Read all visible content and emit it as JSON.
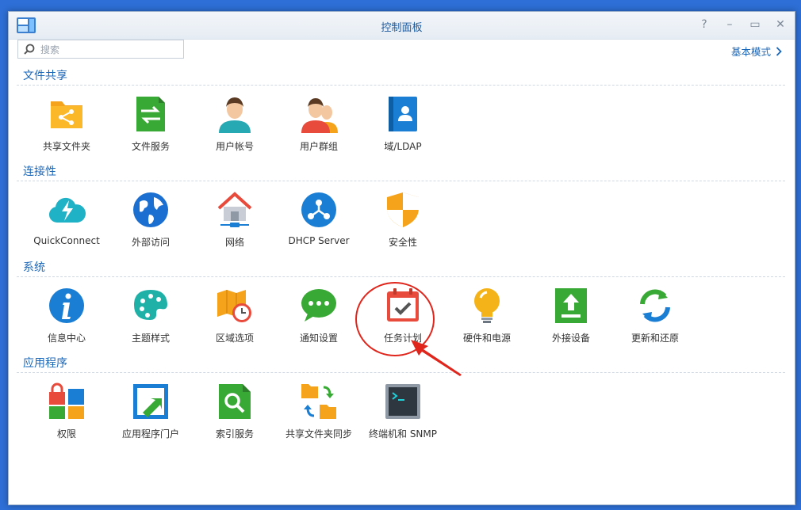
{
  "window": {
    "title": "控制面板",
    "controls": {
      "help": "?",
      "minimize": "–",
      "maximize": "▭",
      "close": "✕"
    }
  },
  "search": {
    "placeholder": "搜索",
    "value": ""
  },
  "mode_link": {
    "label": "基本模式"
  },
  "sections": [
    {
      "title": "文件共享",
      "items": [
        {
          "label": "共享文件夹",
          "icon": "shared-folder-icon"
        },
        {
          "label": "文件服务",
          "icon": "file-services-icon"
        },
        {
          "label": "用户帐号",
          "icon": "user-icon"
        },
        {
          "label": "用户群组",
          "icon": "group-icon"
        },
        {
          "label": "域/LDAP",
          "icon": "ldap-icon"
        }
      ]
    },
    {
      "title": "连接性",
      "items": [
        {
          "label": "QuickConnect",
          "icon": "quickconnect-icon"
        },
        {
          "label": "外部访问",
          "icon": "globe-icon"
        },
        {
          "label": "网络",
          "icon": "network-icon"
        },
        {
          "label": "DHCP Server",
          "icon": "dhcp-icon"
        },
        {
          "label": "安全性",
          "icon": "shield-icon"
        }
      ]
    },
    {
      "title": "系统",
      "items": [
        {
          "label": "信息中心",
          "icon": "info-icon"
        },
        {
          "label": "主题样式",
          "icon": "palette-icon"
        },
        {
          "label": "区域选项",
          "icon": "map-clock-icon"
        },
        {
          "label": "通知设置",
          "icon": "chat-bubble-icon"
        },
        {
          "label": "任务计划",
          "icon": "calendar-check-icon"
        },
        {
          "label": "硬件和电源",
          "icon": "lightbulb-icon"
        },
        {
          "label": "外接设备",
          "icon": "external-device-icon"
        },
        {
          "label": "更新和还原",
          "icon": "refresh-icon"
        }
      ]
    },
    {
      "title": "应用程序",
      "items": [
        {
          "label": "权限",
          "icon": "lock-grid-icon"
        },
        {
          "label": "应用程序门户",
          "icon": "app-portal-icon"
        },
        {
          "label": "索引服务",
          "icon": "index-search-icon"
        },
        {
          "label": "共享文件夹同步",
          "icon": "folder-sync-icon"
        },
        {
          "label": "终端机和 SNMP",
          "icon": "terminal-icon"
        }
      ]
    }
  ]
}
